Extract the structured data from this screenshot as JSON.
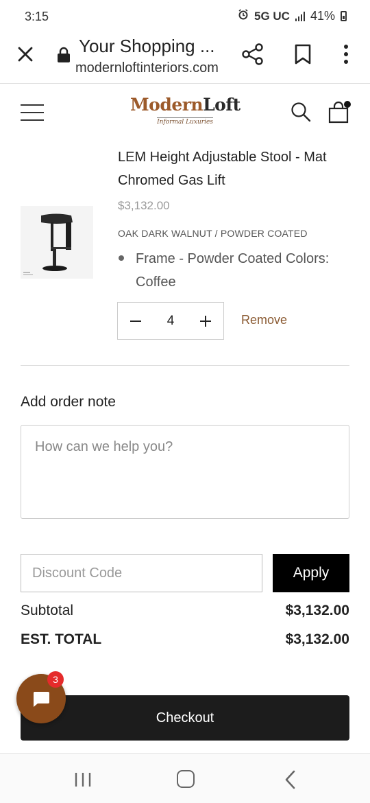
{
  "status_bar": {
    "time": "3:15",
    "network": "5G UC",
    "battery": "41%"
  },
  "browser": {
    "title": "Your Shopping ...",
    "url": "modernloftinteriors.com"
  },
  "site": {
    "logo_part1": "Modern",
    "logo_part2": "Loft",
    "logo_tagline": "Informal Luxuries",
    "logo_accent_color": "#9c5a2a"
  },
  "cart_item": {
    "name": "LEM Height Adjustable Stool - Mat Chromed Gas Lift",
    "price": "$3,132.00",
    "variant": "OAK DARK WALNUT / POWDER COATED",
    "property": "Frame - Powder Coated Colors: Coffee",
    "quantity": "4",
    "remove_label": "Remove"
  },
  "order_note": {
    "label": "Add order note",
    "placeholder": "How can we help you?"
  },
  "discount": {
    "placeholder": "Discount Code",
    "apply_label": "Apply"
  },
  "summary": {
    "subtotal_label": "Subtotal",
    "subtotal_value": "$3,132.00",
    "total_label": "EST. TOTAL",
    "total_value": "$3,132.00"
  },
  "checkout_label": "Checkout",
  "chat": {
    "badge_count": "3"
  }
}
